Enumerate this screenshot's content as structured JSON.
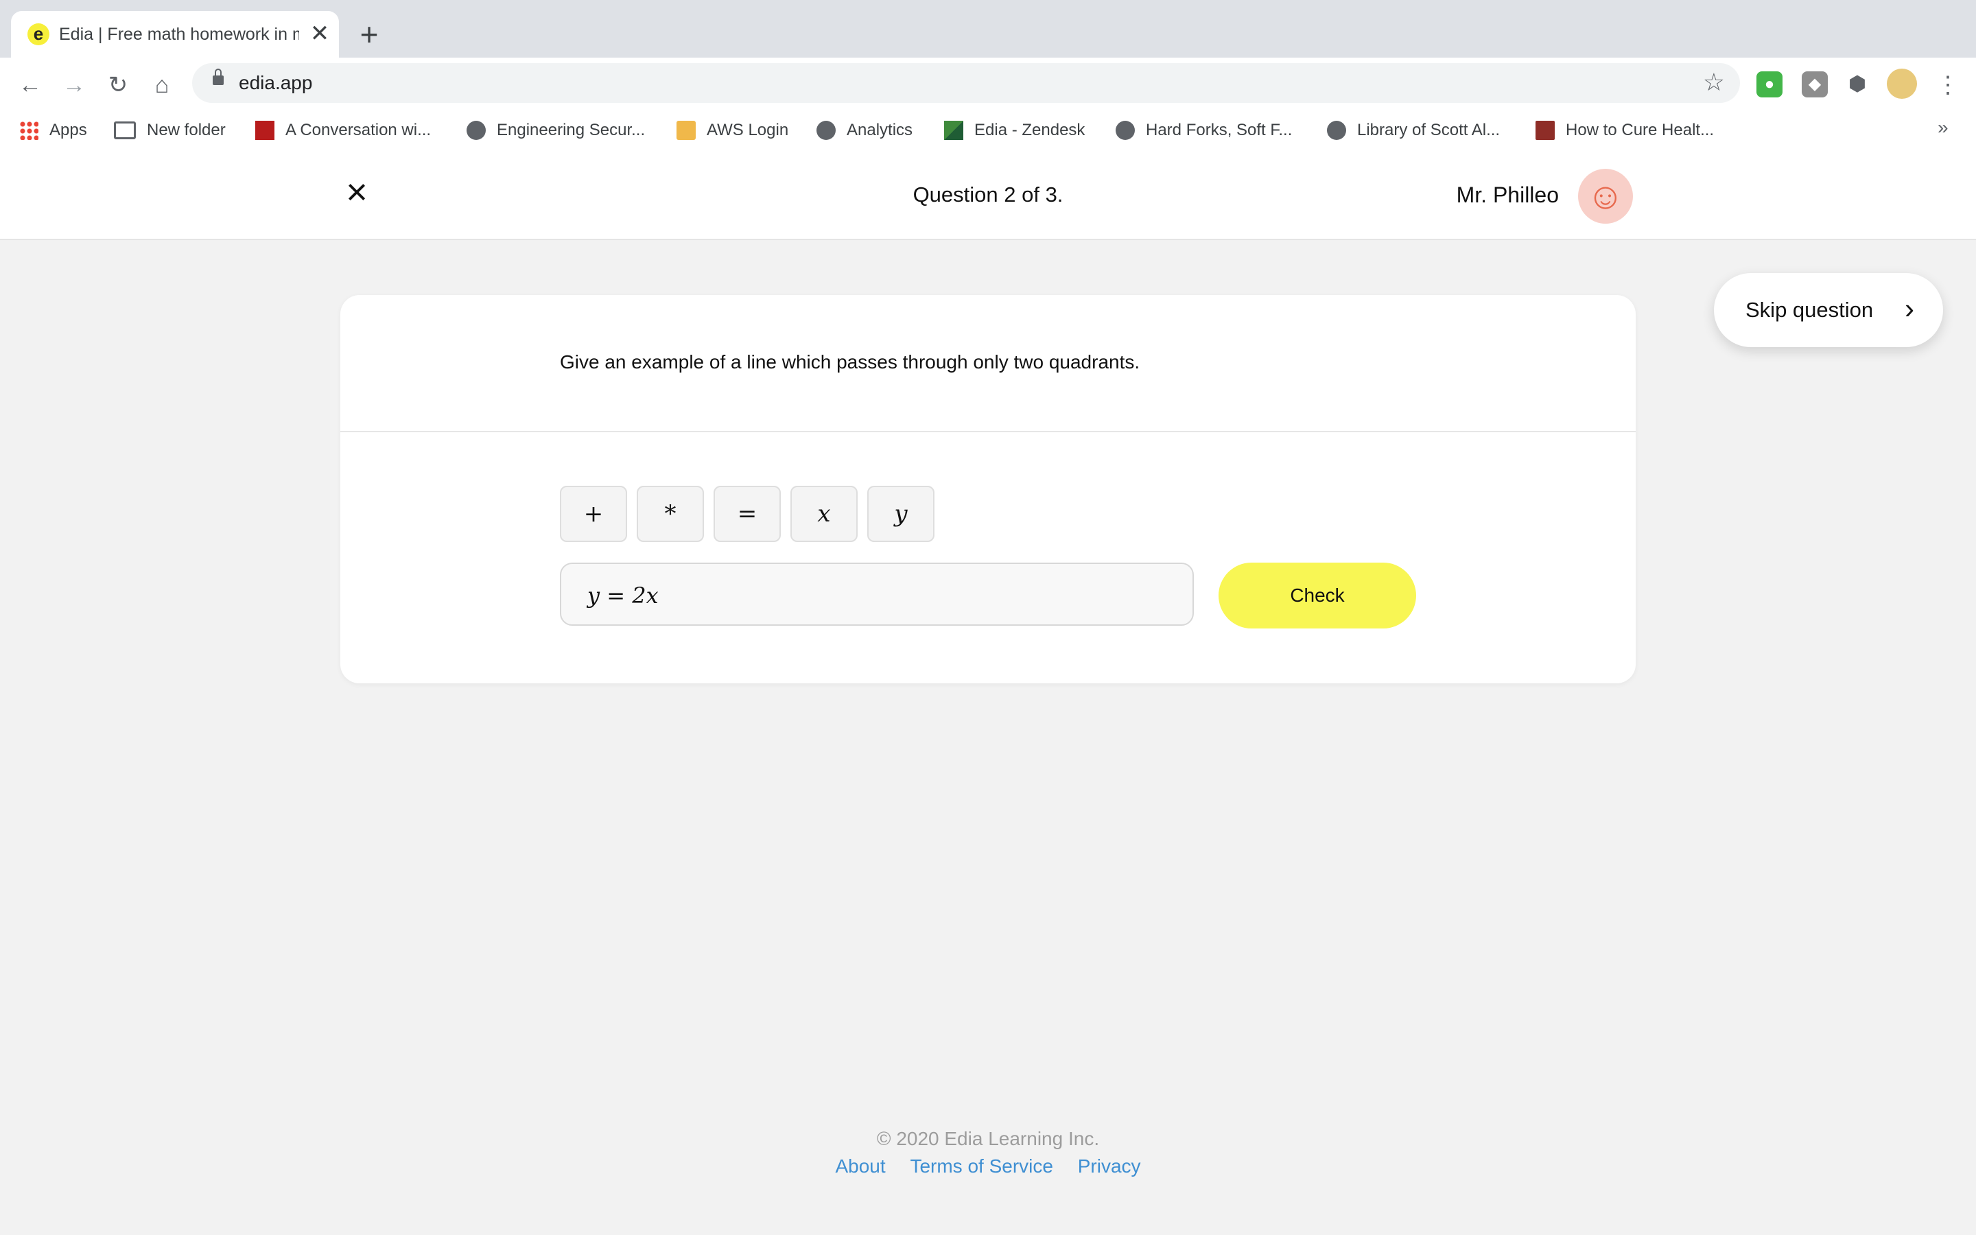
{
  "browser": {
    "tab_title": "Edia | Free math homework in minutes",
    "favicon_letter": "e",
    "close_tab": "✕",
    "new_tab": "+",
    "back": "←",
    "forward": "→",
    "reload": "↻",
    "home": "⌂",
    "url": "edia.app",
    "bookmark_star": "☆",
    "menu": "⋮",
    "bookmarks": [
      {
        "label": "Apps"
      },
      {
        "label": "New folder"
      },
      {
        "label": "A Conversation wi..."
      },
      {
        "label": "Engineering Secur..."
      },
      {
        "label": "AWS Login"
      },
      {
        "label": "Analytics"
      },
      {
        "label": "Edia - Zendesk"
      },
      {
        "label": "Hard Forks, Soft F..."
      },
      {
        "label": "Library of Scott Al..."
      },
      {
        "label": "How to Cure Healt..."
      }
    ],
    "bookmarks_more": "»"
  },
  "header": {
    "close": "×",
    "question_counter": "Question 2 of 3.",
    "user_name": "Mr. Philleo",
    "avatar_face": "☺"
  },
  "skip": {
    "label": "Skip question",
    "chevron": "›"
  },
  "question": {
    "prompt": "Give an example of a line which passes through only two quadrants.",
    "keys": [
      "+",
      "*",
      "=",
      "x",
      "y"
    ],
    "answer": "y = 2x",
    "check_label": "Check"
  },
  "footer": {
    "copyright": "© 2020 Edia Learning Inc.",
    "links": [
      "About",
      "Terms of Service",
      "Privacy"
    ]
  },
  "colors": {
    "accent_yellow": "#f8f654",
    "avatar_bg": "#f8cfc8",
    "link_blue": "#3f8fd2"
  }
}
